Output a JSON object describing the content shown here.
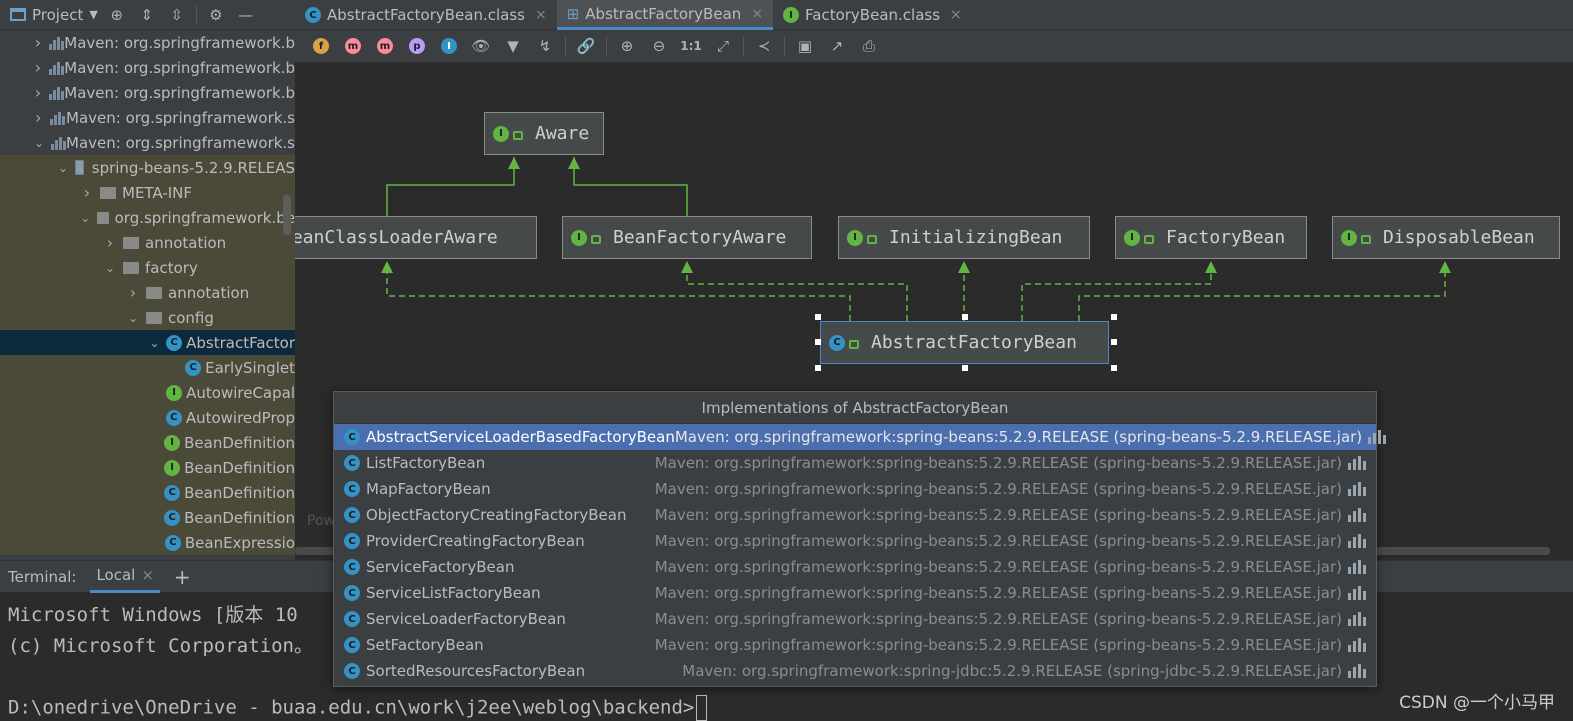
{
  "project_panel": {
    "title": "Project",
    "tree": [
      {
        "depth": 0,
        "arrow": "›",
        "icon": "library",
        "label": "Maven: org.springframework.b"
      },
      {
        "depth": 0,
        "arrow": "›",
        "icon": "library",
        "label": "Maven: org.springframework.b"
      },
      {
        "depth": 0,
        "arrow": "›",
        "icon": "library",
        "label": "Maven: org.springframework.b"
      },
      {
        "depth": 0,
        "arrow": "›",
        "icon": "library",
        "label": "Maven: org.springframework.s"
      },
      {
        "depth": 0,
        "arrow": "⌄",
        "icon": "library",
        "label": "Maven: org.springframework.s"
      },
      {
        "depth": 1,
        "arrow": "⌄",
        "icon": "jar",
        "label": "spring-beans-5.2.9.RELEAS",
        "hl": true
      },
      {
        "depth": 2,
        "arrow": "›",
        "icon": "folder",
        "label": "META-INF",
        "hl": true
      },
      {
        "depth": 2,
        "arrow": "⌄",
        "icon": "folder",
        "label": "org.springframework.be",
        "hl": true
      },
      {
        "depth": 3,
        "arrow": "›",
        "icon": "folder",
        "label": "annotation",
        "hl": true
      },
      {
        "depth": 3,
        "arrow": "⌄",
        "icon": "folder",
        "label": "factory",
        "hl": true
      },
      {
        "depth": 4,
        "arrow": "›",
        "icon": "folder",
        "label": "annotation",
        "hl": true
      },
      {
        "depth": 4,
        "arrow": "⌄",
        "icon": "folder",
        "label": "config",
        "hl": true
      },
      {
        "depth": 5,
        "arrow": "⌄",
        "icon": "class",
        "label": "AbstractFactor",
        "sel": true
      },
      {
        "depth": 6,
        "arrow": "",
        "icon": "class",
        "label": "EarlySinglet",
        "hl": true
      },
      {
        "depth": 5,
        "arrow": "",
        "icon": "interface",
        "label": "AutowireCapal",
        "hl": true
      },
      {
        "depth": 5,
        "arrow": "",
        "icon": "class",
        "label": "AutowiredProp",
        "hl": true
      },
      {
        "depth": 5,
        "arrow": "",
        "icon": "interface",
        "label": "BeanDefinition",
        "hl": true
      },
      {
        "depth": 5,
        "arrow": "",
        "icon": "interface",
        "label": "BeanDefinition",
        "hl": true
      },
      {
        "depth": 5,
        "arrow": "",
        "icon": "class",
        "label": "BeanDefinition",
        "hl": true
      },
      {
        "depth": 5,
        "arrow": "",
        "icon": "class",
        "label": "BeanDefinition",
        "hl": true
      },
      {
        "depth": 5,
        "arrow": "",
        "icon": "class",
        "label": "BeanExpressio",
        "hl": true
      }
    ]
  },
  "tabs": [
    {
      "label": "AbstractFactoryBean.class",
      "icon": "class",
      "active": false
    },
    {
      "label": "AbstractFactoryBean",
      "icon": "diagram",
      "active": true
    },
    {
      "label": "FactoryBean.class",
      "icon": "interface",
      "active": false
    }
  ],
  "toolbar": {
    "buttons": [
      "f",
      "m",
      "m",
      "p",
      "I",
      "eye-icon",
      "filter-icon",
      "route-icon",
      "link-icon",
      "zoom-in-icon",
      "zoom-out-icon",
      "1:1",
      "fit-icon",
      "layout-icon",
      "save-icon",
      "export-icon",
      "print-icon"
    ]
  },
  "diagram": {
    "nodes": {
      "aware": "Aware",
      "bean_class_loader_aware": "BeanClassLoaderAware",
      "bean_factory_aware": "BeanFactoryAware",
      "initializing_bean": "InitializingBean",
      "factory_bean": "FactoryBean",
      "disposable_bean": "DisposableBean",
      "abstract_factory_bean": "AbstractFactoryBean"
    },
    "footer": "Pow"
  },
  "popup": {
    "title": "Implementations of AbstractFactoryBean",
    "rows": [
      {
        "name": "AbstractServiceLoaderBasedFactoryBean",
        "location": "Maven: org.springframework:spring-beans:5.2.9.RELEASE (spring-beans-5.2.9.RELEASE.jar)",
        "selected": true
      },
      {
        "name": "ListFactoryBean",
        "location": "Maven: org.springframework:spring-beans:5.2.9.RELEASE (spring-beans-5.2.9.RELEASE.jar)"
      },
      {
        "name": "MapFactoryBean",
        "location": "Maven: org.springframework:spring-beans:5.2.9.RELEASE (spring-beans-5.2.9.RELEASE.jar)"
      },
      {
        "name": "ObjectFactoryCreatingFactoryBean",
        "location": "Maven: org.springframework:spring-beans:5.2.9.RELEASE (spring-beans-5.2.9.RELEASE.jar)"
      },
      {
        "name": "ProviderCreatingFactoryBean",
        "location": "Maven: org.springframework:spring-beans:5.2.9.RELEASE (spring-beans-5.2.9.RELEASE.jar)"
      },
      {
        "name": "ServiceFactoryBean",
        "location": "Maven: org.springframework:spring-beans:5.2.9.RELEASE (spring-beans-5.2.9.RELEASE.jar)"
      },
      {
        "name": "ServiceListFactoryBean",
        "location": "Maven: org.springframework:spring-beans:5.2.9.RELEASE (spring-beans-5.2.9.RELEASE.jar)"
      },
      {
        "name": "ServiceLoaderFactoryBean",
        "location": "Maven: org.springframework:spring-beans:5.2.9.RELEASE (spring-beans-5.2.9.RELEASE.jar)"
      },
      {
        "name": "SetFactoryBean",
        "location": "Maven: org.springframework:spring-beans:5.2.9.RELEASE (spring-beans-5.2.9.RELEASE.jar)"
      },
      {
        "name": "SortedResourcesFactoryBean",
        "location": "Maven: org.springframework:spring-jdbc:5.2.9.RELEASE (spring-jdbc-5.2.9.RELEASE.jar)"
      }
    ]
  },
  "terminal": {
    "label": "Terminal:",
    "tab": "Local",
    "lines": [
      "Microsoft Windows [版本 10",
      "(c) Microsoft Corporation。"
    ],
    "prompt": "D:\\onedrive\\OneDrive - buaa.edu.cn\\work\\j2ee\\weblog\\backend>"
  },
  "watermark": "CSDN @一个小马甲"
}
